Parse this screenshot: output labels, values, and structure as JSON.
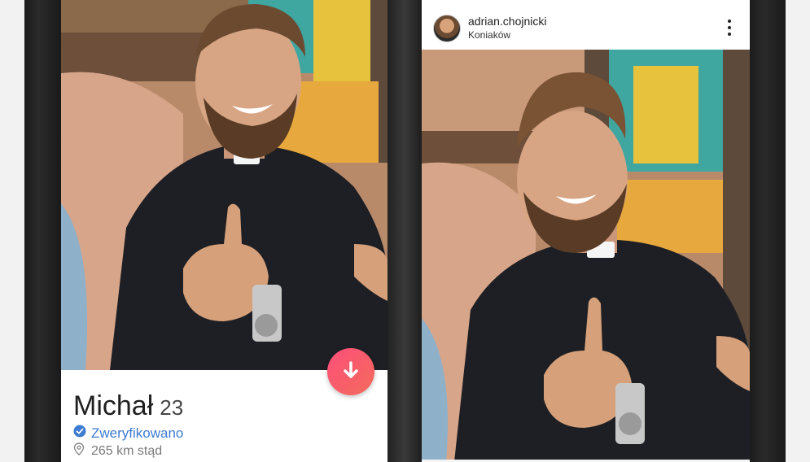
{
  "tinder_card": {
    "name": "Michał",
    "age": "23",
    "verified_label": "Zweryfikowano",
    "distance": "265 km stąd",
    "icons": {
      "verified": "verified-check-icon",
      "location": "location-pin-icon",
      "down": "arrow-down-icon"
    }
  },
  "instagram_post": {
    "username": "adrian.chojnicki",
    "location": "Koniaków",
    "icons": {
      "avatar": "avatar",
      "more": "more-options-icon"
    }
  },
  "colors": {
    "verified_blue": "#3e7bd1",
    "tinder_gradient_start": "#fd4f7a",
    "tinder_gradient_end": "#f36b5c"
  }
}
